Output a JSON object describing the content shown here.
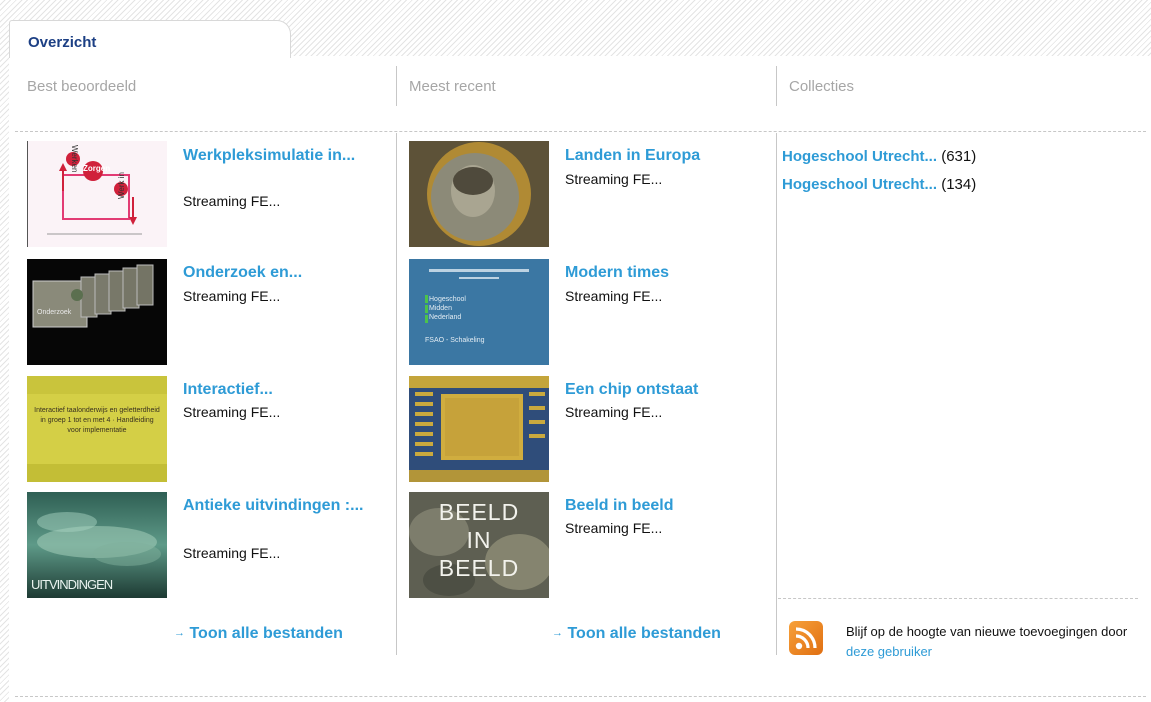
{
  "tab": {
    "label": "Overzicht"
  },
  "columns": {
    "best": {
      "header": "Best beoordeeld",
      "items": [
        {
          "title": "Werkpleksimulatie in...",
          "sub": "Streaming FE..."
        },
        {
          "title": "Onderzoek en...",
          "sub": "Streaming FE..."
        },
        {
          "title": "Interactief...",
          "sub": "Streaming FE..."
        },
        {
          "title": "Antieke uitvindingen :...",
          "sub": "Streaming FE..."
        }
      ],
      "more": "Toon alle bestanden"
    },
    "recent": {
      "header": "Meest recent",
      "items": [
        {
          "title": "Landen in Europa",
          "sub": "Streaming FE..."
        },
        {
          "title": "Modern times",
          "sub": "Streaming FE..."
        },
        {
          "title": "Een chip ontstaat",
          "sub": "Streaming FE..."
        },
        {
          "title": "Beeld in beeld",
          "sub": "Streaming FE..."
        }
      ],
      "more": "Toon alle bestanden"
    },
    "collections": {
      "header": "Collecties",
      "items": [
        {
          "name": "Hogeschool Utrecht...",
          "count": "(631)"
        },
        {
          "name": "Hogeschool Utrecht...",
          "count": "(134)"
        }
      ]
    }
  },
  "thumb_text": {
    "werkplek_a": "Werken",
    "werkplek_b": "Zorgen",
    "werkplek_c": "Werk in",
    "onderzoek": "Onderzoek",
    "interactief": "Interactief taalonderwijs en geletterdheid in groep 1 tot en met 4 · Handleiding voor implementatie",
    "uitvindingen": "UITVINDINGEN",
    "modern_a": "Hogeschool",
    "modern_b": "Midden",
    "modern_c": "Nederland",
    "modern_d": "FSAO - Schakeling",
    "beeld": "BEELD IN BEELD"
  },
  "rss": {
    "text": "Blijf op de hoogte van nieuwe toevoegingen door",
    "link": "deze gebruiker"
  },
  "colors": {
    "title": "#2e9bd6",
    "tab": "#1c3f84",
    "header": "#a6a6a6",
    "rss": "#f0881f"
  }
}
